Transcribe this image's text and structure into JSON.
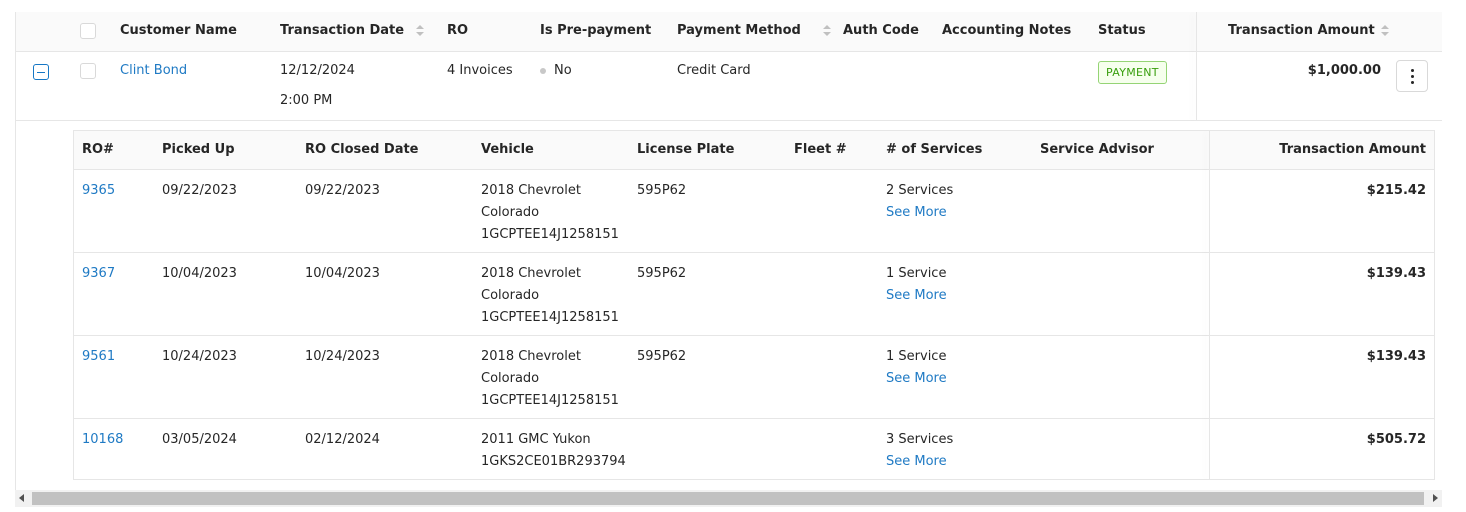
{
  "outer_table": {
    "columns": [
      {
        "label": "Customer Name"
      },
      {
        "label": "Transaction Date"
      },
      {
        "label": "RO"
      },
      {
        "label": "Is Pre-payment"
      },
      {
        "label": "Payment Method"
      },
      {
        "label": "Auth Code"
      },
      {
        "label": "Accounting Notes"
      },
      {
        "label": "Status"
      },
      {
        "label": "Transaction Amount"
      }
    ],
    "row": {
      "customer_name": "Clint Bond",
      "transaction_date": "12/12/2024",
      "transaction_time": "2:00 PM",
      "ro": "4 Invoices",
      "is_prepayment": "No",
      "payment_method": "Credit Card",
      "auth_code": "",
      "accounting_notes": "",
      "status": "PAYMENT",
      "transaction_amount": "$1,000.00"
    }
  },
  "inner_table": {
    "columns": [
      {
        "label": "RO#"
      },
      {
        "label": "Picked Up"
      },
      {
        "label": "RO Closed Date"
      },
      {
        "label": "Vehicle"
      },
      {
        "label": "License Plate"
      },
      {
        "label": "Fleet #"
      },
      {
        "label": "# of Services"
      },
      {
        "label": "Service Advisor"
      },
      {
        "label": "Transaction Amount"
      }
    ],
    "see_more_label": "See More",
    "rows": [
      {
        "ro": "9365",
        "picked_up": "09/22/2023",
        "closed": "09/22/2023",
        "vehicle_l1": "2018 Chevrolet",
        "vehicle_l2": "Colorado",
        "vehicle_l3": "1GCPTEE14J1258151",
        "plate": "595P62",
        "fleet": "",
        "services": "2 Services",
        "advisor": "",
        "amount": "$215.42"
      },
      {
        "ro": "9367",
        "picked_up": "10/04/2023",
        "closed": "10/04/2023",
        "vehicle_l1": "2018 Chevrolet",
        "vehicle_l2": "Colorado",
        "vehicle_l3": "1GCPTEE14J1258151",
        "plate": "595P62",
        "fleet": "",
        "services": "1 Service",
        "advisor": "",
        "amount": "$139.43"
      },
      {
        "ro": "9561",
        "picked_up": "10/24/2023",
        "closed": "10/24/2023",
        "vehicle_l1": "2018 Chevrolet",
        "vehicle_l2": "Colorado",
        "vehicle_l3": "1GCPTEE14J1258151",
        "plate": "595P62",
        "fleet": "",
        "services": "1 Service",
        "advisor": "",
        "amount": "$139.43"
      },
      {
        "ro": "10168",
        "picked_up": "03/05/2024",
        "closed": "02/12/2024",
        "vehicle_l1": "2011 GMC Yukon",
        "vehicle_l2": "1GKS2CE01BR293794",
        "vehicle_l3": "",
        "plate": "",
        "fleet": "",
        "services": "3 Services",
        "advisor": "",
        "amount": "$505.72"
      }
    ]
  },
  "colors": {
    "link": "#1f7ac4",
    "status_green": "#389e0d",
    "header_bg": "#fafafa",
    "border": "#e6e6e6"
  }
}
